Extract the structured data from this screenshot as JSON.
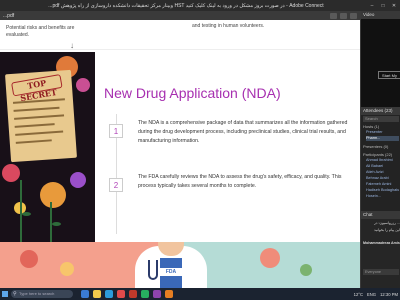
{
  "titlebar": {
    "title": "...pdf  وبینار مرکز تحقیقات دانشکده داروسازی از راه پژوهش HST در صورت بروز مشکل در ورود به لینک کلیک کنید - Adobe Connect",
    "minimize": "–",
    "maximize": "□",
    "close": "✕"
  },
  "share_pod": {
    "doc_label": "...pdf"
  },
  "previous_slide": {
    "line1": "Potential risks and benefits are",
    "line2": "evaluated.",
    "right_text": "and testing in human volunteers.",
    "arrow": "↓"
  },
  "slide": {
    "title": "New Drug Application (NDA)",
    "stamp": "TOP SECRET",
    "points": [
      {
        "num": "1",
        "text": "The NDA is a comprehensive package of data that summarizes all the information gathered during the drug development process, including preclinical studies, clinical trial results, and manufacturing information."
      },
      {
        "num": "2",
        "text": "The FDA carefully reviews the NDA to assess the drug's safety, efficacy, and quality. This process typically takes several months to complete."
      }
    ],
    "badge": "FDA"
  },
  "right_panel": {
    "video": {
      "header": "Video",
      "start_button": "Start My"
    },
    "attendees": {
      "header": "Attendees (23)",
      "search": "Search",
      "groups": [
        {
          "label": "Hosts (1)",
          "items": [
            "Presenter",
            "Pharm..."
          ]
        },
        {
          "label": "Presenters (0)",
          "items": []
        },
        {
          "label": "Participants (22)",
          "items": [
            "Ahmad Ibrahimi",
            "Ali Babaei",
            "Atieh Azizi",
            "Behnaz Arabi",
            "Fatemeh Amini",
            "Hadiseh Bodaghabadi",
            "Hosein..."
          ]
        }
      ]
    },
    "chat": {
      "header": "Chat",
      "tab": "(Everyone)",
      "messages": [
        "رزرواسیون: در ...",
        "این پیام را بخوانید",
        "Mohammadreza Amirzadi: Clinical..."
      ],
      "input_label": "Everyone"
    }
  },
  "taskbar": {
    "search_placeholder": "Type here to search",
    "temperature": "12°C",
    "language": "ENG",
    "time": "12:30 PM"
  }
}
